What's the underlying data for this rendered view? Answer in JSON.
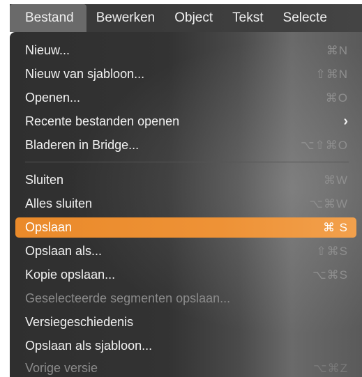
{
  "menubar": {
    "items": [
      {
        "label": "Bestand"
      },
      {
        "label": "Bewerken"
      },
      {
        "label": "Object"
      },
      {
        "label": "Tekst"
      },
      {
        "label": "Selecte"
      }
    ]
  },
  "menu": {
    "group1": [
      {
        "label": "Nieuw...",
        "shortcut": "⌘N",
        "enabled": true
      },
      {
        "label": "Nieuw van sjabloon...",
        "shortcut": "⇧⌘N",
        "enabled": true
      },
      {
        "label": "Openen...",
        "shortcut": "⌘O",
        "enabled": true
      },
      {
        "label": "Recente bestanden openen",
        "submenu": true,
        "chevron": "›",
        "enabled": true
      },
      {
        "label": "Bladeren in Bridge...",
        "shortcut": "⌥⇧⌘O",
        "enabled": true
      }
    ],
    "group2": [
      {
        "label": "Sluiten",
        "shortcut": "⌘W",
        "enabled": true
      },
      {
        "label": "Alles sluiten",
        "shortcut": "⌥⌘W",
        "enabled": true
      },
      {
        "label": "Opslaan",
        "shortcut": "⌘ S",
        "enabled": true,
        "highlighted": true
      },
      {
        "label": "Opslaan als...",
        "shortcut": "⇧⌘S",
        "enabled": true
      },
      {
        "label": "Kopie opslaan...",
        "shortcut": "⌥⌘S",
        "enabled": true
      },
      {
        "label": "Geselecteerde segmenten opslaan...",
        "shortcut": "",
        "enabled": false
      },
      {
        "label": "Versiegeschiedenis",
        "shortcut": "",
        "enabled": true
      },
      {
        "label": "Opslaan als sjabloon...",
        "shortcut": "",
        "enabled": true
      },
      {
        "label": "Vorige versie",
        "shortcut": "⌥⌘Z",
        "enabled": false
      }
    ]
  },
  "colors": {
    "highlight": "#ee9236",
    "menu_background": "#333333",
    "menubar_active": "#6a6a6a"
  }
}
